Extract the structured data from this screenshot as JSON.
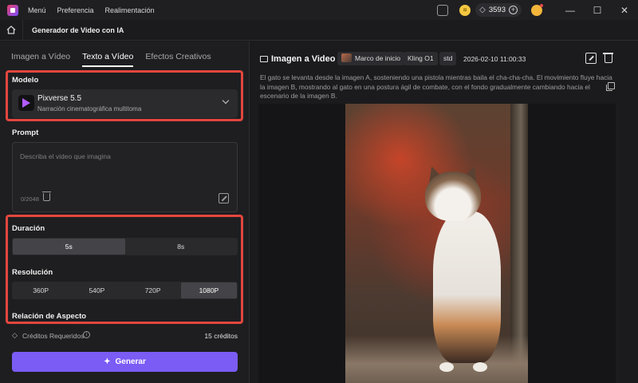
{
  "titlebar": {
    "menu": [
      "Menú",
      "Preferencia",
      "Realimentación"
    ],
    "credits": "3593",
    "window_buttons": [
      "—",
      "☐",
      "✕"
    ]
  },
  "navbar": {
    "title": "Generador de Video con IA"
  },
  "left": {
    "tabs": [
      {
        "label": "Imagen a Vídeo",
        "active": false
      },
      {
        "label": "Texto a Vídeo",
        "active": true
      },
      {
        "label": "Efectos Creativos",
        "active": false
      }
    ],
    "model": {
      "section_label": "Modelo",
      "name": "Pixverse 5.5",
      "description": "Narración cinematográfica multitoma"
    },
    "prompt": {
      "section_label": "Prompt",
      "placeholder": "Describa el video que imagina",
      "count": "0/2048"
    },
    "duration": {
      "section_label": "Duración",
      "options": [
        "5s",
        "8s"
      ],
      "selected": "5s"
    },
    "resolution": {
      "section_label": "Resolución",
      "options": [
        "360P",
        "540P",
        "720P",
        "1080P"
      ],
      "selected": "1080P"
    },
    "aspect": {
      "section_label": "Relación de Aspecto"
    },
    "credits_required": {
      "label": "Créditos Requeridos",
      "value": "15 créditos"
    },
    "generate_label": "Generar"
  },
  "right": {
    "title": "Imagen a Video",
    "chips": [
      "Marco de inicio",
      "Kling O1",
      "std"
    ],
    "timestamp": "2026-02-10 11:00:33",
    "description": "El gato se levanta desde la imagen A, sosteniendo una pistola mientras baila el cha-cha-cha. El movimiento fluye hacia la imagen B, mostrando al gato en una postura ágil de combate, con el fondo gradualmente cambiando hacia el escenario de la imagen B."
  },
  "colors": {
    "accent": "#7b5cf5",
    "highlight": "#e3463f",
    "background": "#1b1b1d"
  },
  "icons": [
    "app-logo-icon",
    "home-icon",
    "coin-icon",
    "diamond-icon",
    "avatar-icon",
    "minimize-icon",
    "maximize-icon",
    "close-icon",
    "chevron-down-icon",
    "trash-icon",
    "magic-wand-icon",
    "info-icon",
    "sparkle-icon",
    "image-icon",
    "edit-icon",
    "copy-icon"
  ]
}
